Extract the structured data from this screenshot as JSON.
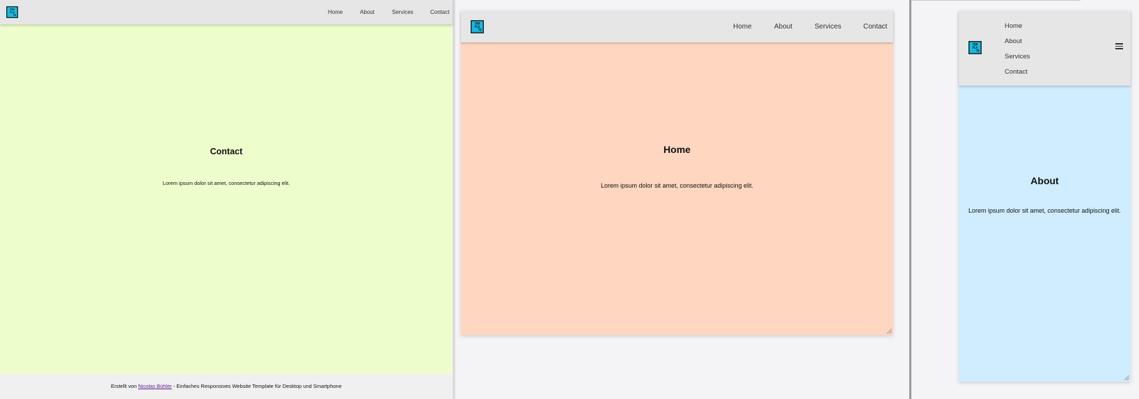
{
  "logo": {
    "name": "template-logo",
    "line1": "TEM",
    "line2": "PLA",
    "line3": "TE",
    "bg": "#1ab8e0"
  },
  "nav": {
    "items": [
      "Home",
      "About",
      "Services",
      "Contact"
    ]
  },
  "panels": [
    {
      "page_title": "Contact",
      "body_text": "Lorem ipsum dolor sit amet, consectetur adipiscing elit.",
      "bg": "#eefdcc"
    },
    {
      "page_title": "Home",
      "body_text": "Lorem ipsum dolor sit amet, consectetur adipiscing elit.",
      "bg": "#ffd6bf"
    },
    {
      "page_title": "About",
      "body_text": "Lorem ipsum dolor sit amet, consectetur adipiscing elit.",
      "bg": "#cfedfe",
      "menu_icon": "hamburger-menu-icon"
    }
  ],
  "footer": {
    "prefix": "Erstellt von ",
    "author_link": "Nicolas Bühler",
    "suffix": " - Einfaches Responsives Website Template für Desktop und Smartphone"
  }
}
